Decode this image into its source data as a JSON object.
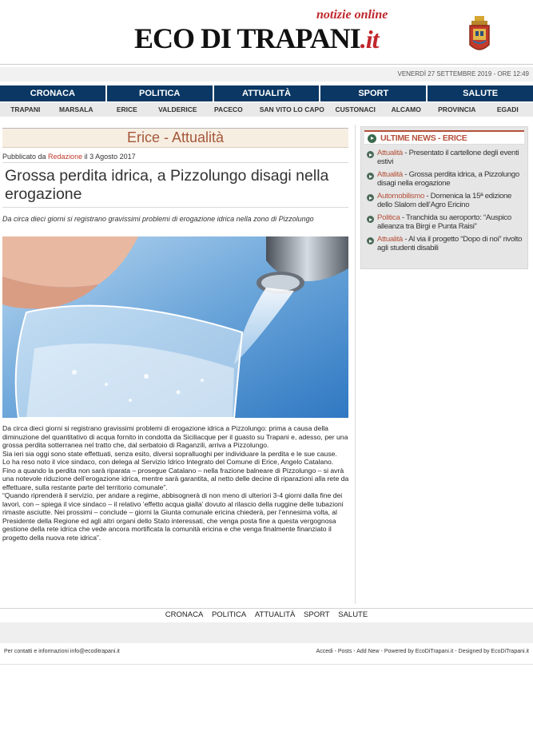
{
  "header": {
    "tagline": "notizie online",
    "brand_main": "ECO DI TRAPANI",
    "brand_suffix": ".it",
    "date_line": "VENERDÌ 27 SETTEMBRE 2019 - ORE 12:49"
  },
  "main_nav": [
    "CRONACA",
    "POLITICA",
    "ATTUALITÀ",
    "SPORT",
    "SALUTE"
  ],
  "sub_nav": [
    "TRAPANI",
    "MARSALA",
    "ERICE",
    "VALDERICE",
    "PACECO",
    "SAN VITO LO CAPO",
    "CUSTONACI",
    "ALCAMO",
    "PROVINCIA",
    "EGADI"
  ],
  "article": {
    "section": "Erice - Attualità",
    "byline_prefix": "Pubblicato da ",
    "author": "Redazione",
    "byline_suffix": " il 3 Agosto 2017",
    "headline": "Grossa perdita idrica, a Pizzolungo disagi nella erogazione",
    "summary": "Da circa dieci giorni si registrano gravissimi problemi di erogazione idrica nella zono di Pizzolungo",
    "paragraphs": [
      "Da circa dieci giorni si registrano gravissimi problemi di erogazione idrica a Pizzolungo: prima a causa della diminuzione del quantitativo di acqua fornito in condotta da Siciliacque per il guasto su Trapani e, adesso, per una grossa perdita sotterranea nel tratto che, dal serbatoio di Raganzili, arriva a Pizzolungo.",
      "Sia ieri sia oggi sono state effettuati, senza esito, diversi sopralluoghi per individuare la perdita e le sue cause.",
      "Lo ha reso noto il vice sindaco, con delega al Servizio Idrico Integrato del Comune di Erice, Angelo Catalano.",
      "Fino a quando la perdita non sarà riparata – prosegue Catalano – nella frazione balneare di Pizzolungo – si avrà una notevole riduzione dell’erogazione idrica, mentre sarà garantita, al netto delle decine di riparazioni alla rete da effettuare, sulla restante parte del territorio comunale”.",
      "“Quando riprenderà il servizio, per andare a regime, abbisognerà di non meno di ulteriori 3-4 giorni dalla fine dei lavori, con – spiega il vice sindaco – il relativo ‘effetto acqua gialla’ dovuto al rilascio della ruggine delle tubazioni rimaste asciutte. Nei prossimi – conclude – giorni la Giunta comunale ericina chiederà, per l’ennesima volta, al Presidente della Regione ed agli altri organi dello Stato interessati, che venga posta fine a questa vergognosa gestione della rete idrica che vede ancora mortificata la comunità ericina e che venga finalmente finanziato il progetto della nuova rete idrica”."
    ]
  },
  "sidebar": {
    "heading": "ULTIME NEWS - ERICE",
    "items": [
      {
        "category": "Attualità",
        "title": " - Presentato il cartellone degli eventi estivi"
      },
      {
        "category": "Attualità",
        "title": " - Grossa perdita idrica, a Pizzolungo disagi nella erogazione"
      },
      {
        "category": "Automobilismo",
        "title": " - Domenica la 15ª edizione dello Slalom dell’Agro Ericino"
      },
      {
        "category": "Politica",
        "title": " - Tranchida su aeroporto: “Auspico alleanza tra Birgi e Punta Raisi”"
      },
      {
        "category": "Attualità",
        "title": " - Al via il progetto “Dopo di noi” rivolto agli studenti disabili"
      }
    ]
  },
  "footer": {
    "nav": [
      "CRONACA",
      "POLITICA",
      "ATTUALITÀ",
      "SPORT",
      "SALUTE"
    ],
    "contact": "Per contatti e informazioni info@ecoditrapani.it",
    "credits": "Accedi - Posts - Add New - Powered by EcoDiTrapani.it - Designed by EcoDiTrapani.it"
  },
  "colors": {
    "nav_bg": "#0a3763",
    "accent": "#c0262b",
    "section_text": "#a4583a"
  }
}
